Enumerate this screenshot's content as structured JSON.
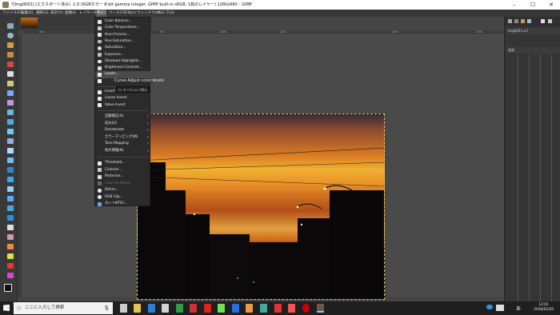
{
  "window": {
    "title": "*[Img0001] (エクスポート済み) -1.0 (RGBカラー 8-bit gamma integer, GIMP built-in sRGB, 1枚のレイヤー) 1280x960 – GIMP"
  },
  "menubar": [
    "ファイル(F)",
    "編集(E)",
    "選択(S)",
    "表示(V)",
    "画像(I)",
    "レイヤー(L)",
    "色(C)",
    "ツール(T)",
    "Filters",
    "ウィンドウ(W)",
    "ヘルプ(H)"
  ],
  "active_menu": "色(C)",
  "ruler": {
    "ticks": [
      "250",
      "500",
      "750",
      "1000",
      "1250",
      "1500",
      "1750"
    ]
  },
  "colors_menu": {
    "items": [
      {
        "label": "Color Balance...",
        "icon": "color-balance-icon"
      },
      {
        "label": "Color Temperature...",
        "icon": "temperature-icon"
      },
      {
        "label": "Hue-Chroma...",
        "icon": "hue-chroma-icon"
      },
      {
        "label": "Hue-Saturation...",
        "icon": "hue-saturation-icon"
      },
      {
        "label": "Saturation...",
        "icon": "saturation-icon"
      },
      {
        "label": "Exposure...",
        "icon": "exposure-icon"
      },
      {
        "label": "Shadows-Highlights...",
        "icon": "shadows-highlights-icon"
      },
      {
        "label": "Brightness-Contrast...",
        "icon": "brightness-contrast-icon"
      },
      {
        "label": "Levels...",
        "icon": "levels-icon",
        "highlighted": true
      },
      {
        "label": "Curve",
        "icon": "curves-icon"
      },
      {
        "label": "Invert",
        "icon": "invert-icon"
      },
      {
        "label": "Linear Invert",
        "icon": "linear-invert-icon"
      },
      {
        "label": "Value Invert",
        "icon": "value-invert-icon"
      },
      {
        "label": "自動補正(A)",
        "submenu": true
      },
      {
        "label": "成分(O)",
        "submenu": true
      },
      {
        "label": "Desaturate",
        "submenu": true
      },
      {
        "label": "カラーマッピング(M)",
        "submenu": true
      },
      {
        "label": "Tone Mapping",
        "submenu": true
      },
      {
        "label": "色の情報(N)",
        "submenu": true
      },
      {
        "label": "Threshold...",
        "icon": "threshold-icon"
      },
      {
        "label": "Colorize...",
        "icon": "colorize-icon"
      },
      {
        "label": "Posterize...",
        "icon": "posterize-icon"
      },
      {
        "label": "Color to Alpha...",
        "icon": "color-to-alpha-icon",
        "disabled": true
      },
      {
        "label": "Dither...",
        "icon": "dither-icon"
      },
      {
        "label": "RGB Clip...",
        "icon": "rgb-clip-icon"
      },
      {
        "label": "ホットNTSC...",
        "icon": "hot-icon"
      }
    ]
  },
  "tooltip": {
    "curve_label": "Curve Adjust color levels",
    "shortcut": "F1 キーでヘルプ表示"
  },
  "dock": {
    "tab_label": "Img0001.xcf",
    "row_label": "画面"
  },
  "taskbar": {
    "search_placeholder": "ここに入力して検索",
    "time": "12:01",
    "date": "2018/02/26",
    "ime": "あ"
  },
  "accent_colors": {
    "highlight": "#4a4a4a",
    "selection_border": "#d8c860"
  }
}
